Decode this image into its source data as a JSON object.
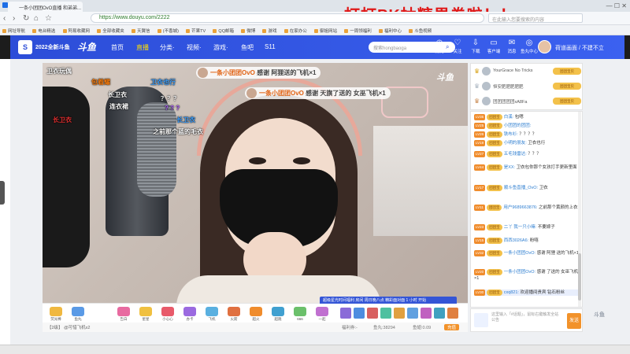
{
  "browser": {
    "tab_title": "一条小团团OvO直播 和弟弟...",
    "url": "https://www.douyu.com/2222",
    "search_placeholder": "在此输入您要搜索的内容",
    "window_controls": "— ☐ ✕",
    "nav": {
      "back": "‹",
      "forward": "›",
      "refresh": "↻",
      "home": "⌂",
      "star": "☆"
    },
    "bookmarks": [
      "网址导航",
      "电台精选",
      "阿易收藏网",
      "全部收藏夹",
      "天翼信",
      "(不香城)",
      "芒果TV",
      "QQ邮箱",
      "微博",
      "游戏",
      "在家办公",
      "御姐网站",
      "一周领福利",
      "福利中心",
      "斗鱼视频"
    ]
  },
  "banner_text": "打打PK抽糖果券啦！！",
  "douyu": {
    "event_label": "2022全新斗鱼",
    "logo_text": "斗鱼",
    "nav_items": [
      "首页",
      "直播",
      "分类·",
      "视频·",
      "游戏·",
      "鱼吧",
      "S11"
    ],
    "search_placeholder": "搜索hongbaoga",
    "header_icons": [
      {
        "label": "历史",
        "icon": "clock-icon"
      },
      {
        "label": "关注",
        "icon": "heart-icon"
      },
      {
        "label": "下载",
        "icon": "download-icon"
      },
      {
        "label": "客户端",
        "icon": "client-icon"
      },
      {
        "label": "消息",
        "icon": "message-icon"
      },
      {
        "label": "鱼丸中心",
        "icon": "fish-icon"
      }
    ],
    "username": "荷道画面 / 不建不立"
  },
  "video": {
    "watermark": "斗鱼",
    "danmaku": [
      {
        "text": "卫衣玩偶",
        "color": "#ffffff"
      },
      {
        "text": "包着耀",
        "color": "#f07a10"
      },
      {
        "text": "卫衣也行",
        "color": "#3da0ff"
      },
      {
        "text": "长卫衣",
        "color": "#ffffff"
      },
      {
        "text": "连衣裙",
        "color": "#ffffff"
      },
      {
        "text": "？？？",
        "color": "#ffffff"
      },
      {
        "text": "长卫衣",
        "color": "#e03030"
      },
      {
        "text": "长卫衣",
        "color": "#3da0ff"
      },
      {
        "text": "之前那个蓝的毛衣",
        "color": "#ffffff"
      },
      {
        "text": "? ? ?",
        "color": "#b060ff"
      }
    ],
    "gift_notices": [
      {
        "name": "一条小团团OvO",
        "text": "感谢 阿狸送的飞机×1"
      },
      {
        "name": "一条小团团OvO",
        "text": "感谢 天旗了送的 女巫飞机×1"
      }
    ]
  },
  "giftbar": {
    "promo": "超级星光时间福利 房间 周日晚八点 精彩面对面 1 小时 开始",
    "gifts": [
      "荧光棒",
      "鱼丸",
      "告白",
      "星星",
      "小心心",
      "办卡",
      "飞机",
      "火箭",
      "超火",
      "超跑",
      "666",
      "一起"
    ],
    "item_colors": [
      "#8a6bd8",
      "#4e8de0",
      "#d86060",
      "#4ec0a0",
      "#e0a040",
      "#60a0e0",
      "#c060c0",
      "#40a0c0",
      "#e08040"
    ],
    "below_text": "【2级】 @可惜飞机x2",
    "stats": [
      "福利券:-",
      "鱼丸:38294",
      "鱼翅:0.09"
    ],
    "recharge_label": "充值"
  },
  "rank": [
    {
      "name": "YourGrace No Tricks",
      "badge": "团团宝贝"
    },
    {
      "name": "恒安肥肥肥肥肥",
      "badge": "团团宝贝"
    },
    {
      "name": "团团团团团xA8Fa",
      "badge": "团团宝贝"
    }
  ],
  "chat": [
    {
      "lvl": "LV35",
      "fan": "团团宝",
      "name": "白溪:",
      "msg": "包嗯"
    },
    {
      "lvl": "LV25",
      "fan": "团团宝",
      "name": "小团团的团团:",
      "msg": ""
    },
    {
      "lvl": "LV26",
      "fan": "团团宝",
      "name": "铁布衫:",
      "msg": "？？？？"
    },
    {
      "lvl": "LV19",
      "fan": "团团宝",
      "name": "小明的朋友:",
      "msg": "卫衣也行"
    },
    {
      "lvl": "LV27",
      "fan": "团团宝",
      "name": "五毛钱雷达:",
      "msg": "？？？"
    },
    {
      "lvl": "LV44",
      "fan": "团团宝",
      "name": "是XX:",
      "msg": "卫衣包你那个女孩打手更新里面"
    },
    {
      "lvl": "LV17",
      "fan": "团团宝",
      "name": "顺斗鱼直播_OvO:",
      "msg": "卫衣"
    },
    {
      "lvl": "LV11",
      "fan": "团团宝",
      "name": "用户9689663876:",
      "msg": "之前那个黄颜的上衣"
    },
    {
      "lvl": "LV23",
      "fan": "团团宝",
      "name": "二丫 我一只小嘛:",
      "msg": "不要嫁子"
    },
    {
      "lvl": "LV15",
      "fan": "团团宝",
      "name": "西西3026A6:",
      "msg": "粉嘻"
    },
    {
      "lvl": "LV32",
      "fan": "团团宝",
      "name": "一条小团团OvO:",
      "msg": "感谢 阿狸 送的飞机×1"
    },
    {
      "lvl": "LV20",
      "fan": "团团宝",
      "name": "一条小团团OvO:",
      "msg": "感谢 了送的 女巫飞机×1"
    },
    {
      "lvl": "LV30",
      "fan": "团团宝",
      "name": "cxq821:",
      "msg": "欢迎播间贵宾 钻石粉丝"
    }
  ],
  "chat_input": {
    "placeholder": "这里输入「#话题」，鼠标右键触发全站公告",
    "send_label": "发送"
  },
  "side_logo": "斗鱼",
  "left_handle": "‹"
}
